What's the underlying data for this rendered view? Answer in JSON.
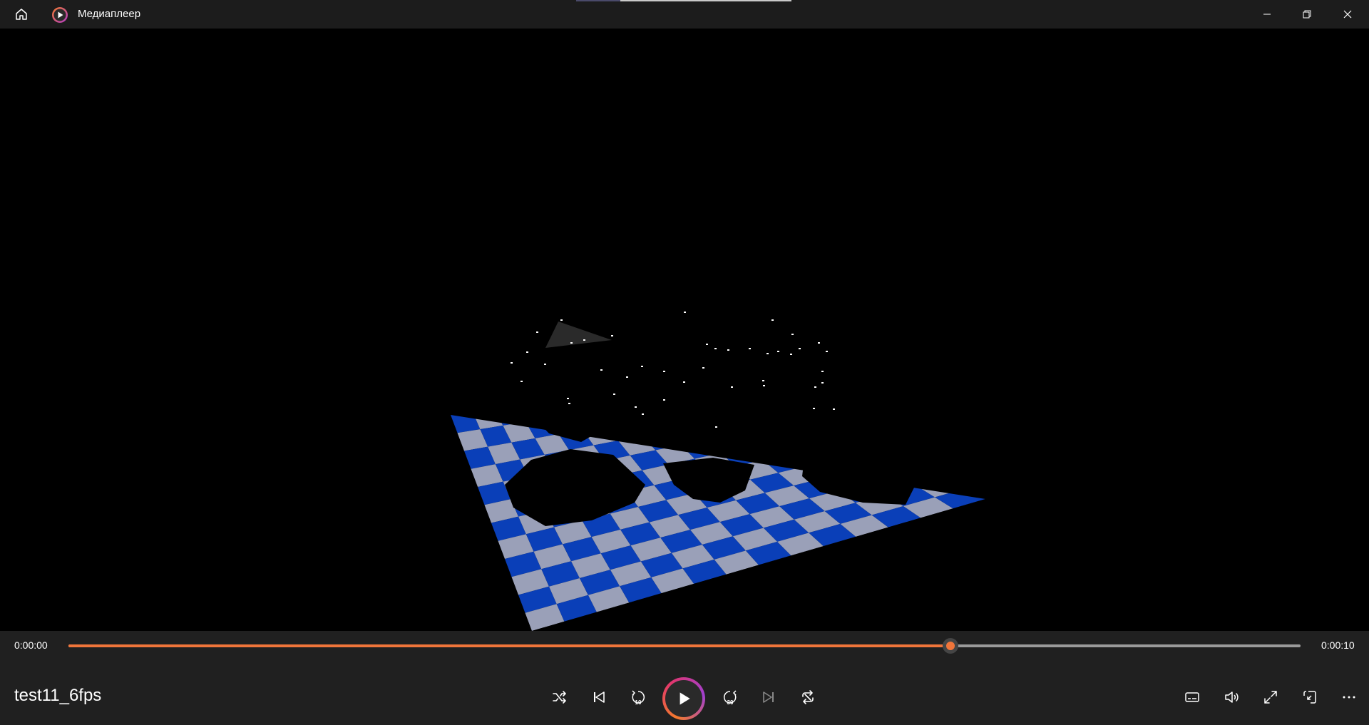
{
  "app": {
    "title": "Медиаплеер"
  },
  "player": {
    "current_time": "0:00:00",
    "total_time": "0:00:10",
    "progress_percent": 71.6,
    "media_title": "test11_6fps",
    "skip_back_seconds": "10",
    "skip_forward_seconds": "30"
  },
  "colors": {
    "accent": "#f0753a",
    "checker_blue": "#0a3fb8",
    "checker_gray": "#9aa0b8",
    "titlebar_bg": "#1c1c1c",
    "controls_bg": "#202020"
  },
  "icons": {
    "home": "home-icon",
    "app_logo": "media-player-logo-icon",
    "minimize": "minimize-icon",
    "restore": "restore-icon",
    "close": "close-icon",
    "shuffle": "shuffle-icon",
    "previous": "previous-icon",
    "skip_back": "skip-back-10-icon",
    "play": "play-icon",
    "skip_forward": "skip-forward-30-icon",
    "next": "next-icon",
    "repeat": "repeat-icon",
    "subtitles": "subtitles-icon",
    "volume": "volume-icon",
    "fullscreen": "fullscreen-icon",
    "miniplayer": "miniplayer-icon",
    "more": "more-icon"
  }
}
